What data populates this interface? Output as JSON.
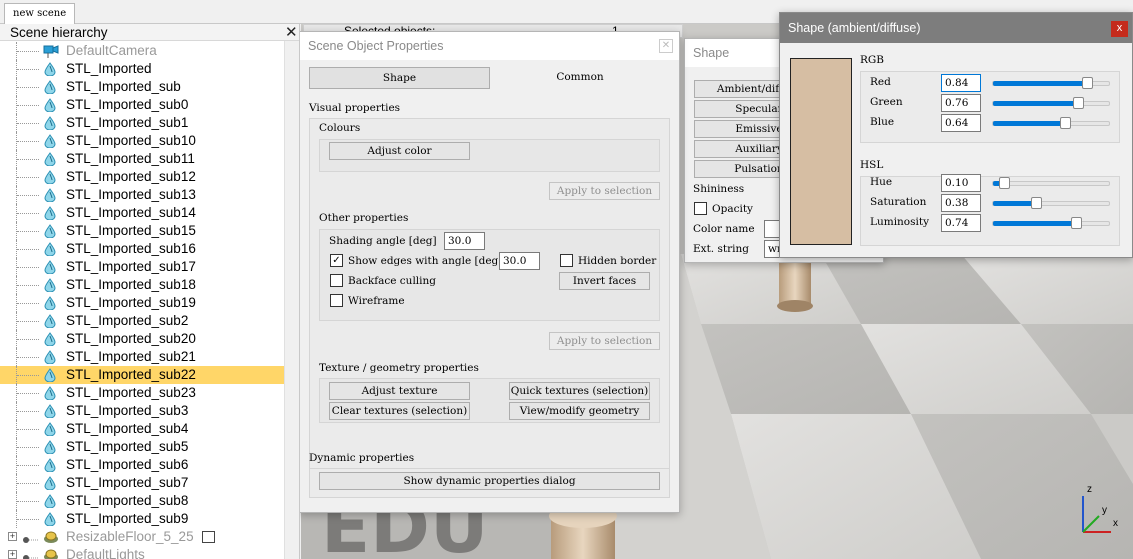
{
  "top_tab": {
    "label": "new scene"
  },
  "hierarchy": {
    "title": "Scene hierarchy",
    "close": "✕",
    "items": [
      {
        "label": "DefaultCamera",
        "icon": "camera-icon",
        "dim": true
      },
      {
        "label": "STL_Imported",
        "icon": "shape-icon",
        "selected": false
      },
      {
        "label": "STL_Imported_sub",
        "icon": "shape-icon"
      },
      {
        "label": "STL_Imported_sub0",
        "icon": "shape-icon"
      },
      {
        "label": "STL_Imported_sub1",
        "icon": "shape-icon"
      },
      {
        "label": "STL_Imported_sub10",
        "icon": "shape-icon"
      },
      {
        "label": "STL_Imported_sub11",
        "icon": "shape-icon"
      },
      {
        "label": "STL_Imported_sub12",
        "icon": "shape-icon"
      },
      {
        "label": "STL_Imported_sub13",
        "icon": "shape-icon"
      },
      {
        "label": "STL_Imported_sub14",
        "icon": "shape-icon"
      },
      {
        "label": "STL_Imported_sub15",
        "icon": "shape-icon"
      },
      {
        "label": "STL_Imported_sub16",
        "icon": "shape-icon"
      },
      {
        "label": "STL_Imported_sub17",
        "icon": "shape-icon"
      },
      {
        "label": "STL_Imported_sub18",
        "icon": "shape-icon"
      },
      {
        "label": "STL_Imported_sub19",
        "icon": "shape-icon"
      },
      {
        "label": "STL_Imported_sub2",
        "icon": "shape-icon"
      },
      {
        "label": "STL_Imported_sub20",
        "icon": "shape-icon"
      },
      {
        "label": "STL_Imported_sub21",
        "icon": "shape-icon"
      },
      {
        "label": "STL_Imported_sub22",
        "icon": "shape-icon",
        "selected": true
      },
      {
        "label": "STL_Imported_sub23",
        "icon": "shape-icon"
      },
      {
        "label": "STL_Imported_sub3",
        "icon": "shape-icon"
      },
      {
        "label": "STL_Imported_sub4",
        "icon": "shape-icon"
      },
      {
        "label": "STL_Imported_sub5",
        "icon": "shape-icon"
      },
      {
        "label": "STL_Imported_sub6",
        "icon": "shape-icon"
      },
      {
        "label": "STL_Imported_sub7",
        "icon": "shape-icon"
      },
      {
        "label": "STL_Imported_sub8",
        "icon": "shape-icon"
      },
      {
        "label": "STL_Imported_sub9",
        "icon": "shape-icon"
      },
      {
        "label": "ResizableFloor_5_25",
        "icon": "model-icon",
        "dim": true
      },
      {
        "label": "DefaultLights",
        "icon": "model-icon",
        "dim": true
      }
    ]
  },
  "selected_objects": {
    "label": "Selected objects:",
    "count": "1"
  },
  "props": {
    "title": "Scene Object Properties",
    "tabs": [
      "Shape",
      "Common"
    ],
    "visual_properties": "Visual properties",
    "colours": "Colours",
    "adjust_color": "Adjust color",
    "apply_selection": "Apply to selection",
    "other_properties": "Other properties",
    "shading_angle_label": "Shading angle [deg]",
    "shading_angle_value": "30.0",
    "show_edges_label": "Show edges with angle [deg]",
    "show_edges_value": "30.0",
    "hidden_border": "Hidden border",
    "backface_culling": "Backface culling",
    "invert_faces": "Invert faces",
    "wireframe": "Wireframe",
    "texture_geometry": "Texture / geometry properties",
    "adjust_texture": "Adjust texture",
    "quick_textures": "Quick textures (selection)",
    "clear_textures": "Clear textures (selection)",
    "view_geometry": "View/modify geometry",
    "dynamic_properties": "Dynamic properties",
    "show_dynamic": "Show dynamic properties dialog"
  },
  "shape_panel": {
    "title": "Shape",
    "buttons": [
      "Ambient/diffuse",
      "Specular",
      "Emissive",
      "Auxiliary",
      "Pulsation"
    ],
    "shininess": "Shininess",
    "opacity": "Opacity",
    "color_name": "Color name",
    "ext_string": "Ext. string",
    "ext_string_value": "wrap"
  },
  "color_dialog": {
    "title": "Shape (ambient/diffuse)",
    "close": "x",
    "swatch": "#d6bea3",
    "rgb_title": "RGB",
    "hsl_title": "HSL",
    "rgb": [
      {
        "label": "Red",
        "value": "0.84",
        "level": 0.84
      },
      {
        "label": "Green",
        "value": "0.76",
        "level": 0.76
      },
      {
        "label": "Blue",
        "value": "0.64",
        "level": 0.64
      }
    ],
    "hsl": [
      {
        "label": "Hue",
        "value": "0.10",
        "level": 0.1
      },
      {
        "label": "Saturation",
        "value": "0.38",
        "level": 0.38
      },
      {
        "label": "Luminosity",
        "value": "0.74",
        "level": 0.74
      }
    ]
  },
  "axis_gizmo": {
    "x": "x",
    "y": "y",
    "z": "z"
  }
}
